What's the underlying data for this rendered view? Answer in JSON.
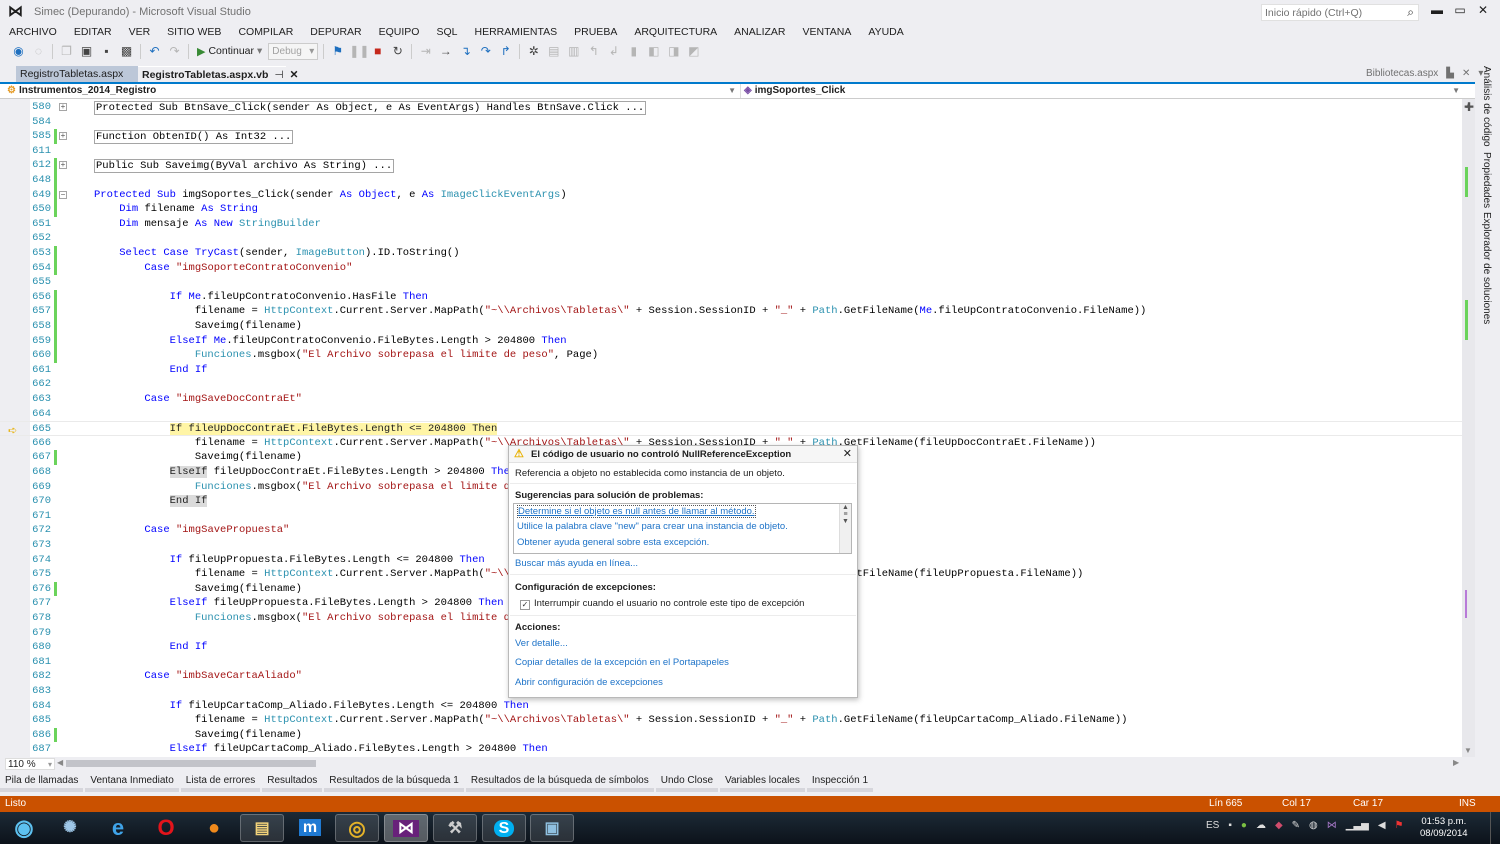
{
  "window": {
    "title": "Simec (Depurando) - Microsoft Visual Studio",
    "quick_launch_placeholder": "Inicio rápido (Ctrl+Q)"
  },
  "menu": [
    "ARCHIVO",
    "EDITAR",
    "VER",
    "SITIO WEB",
    "COMPILAR",
    "DEPURAR",
    "EQUIPO",
    "SQL",
    "HERRAMIENTAS",
    "PRUEBA",
    "ARQUITECTURA",
    "ANALIZAR",
    "VENTANA",
    "AYUDA"
  ],
  "toolbar": {
    "continue_label": "Continuar",
    "config_value": "Debug"
  },
  "tabs": [
    {
      "label": "RegistroTabletas.aspx"
    },
    {
      "label": "RegistroTabletas.aspx.vb",
      "active": true
    }
  ],
  "preview_tab": "Bibliotecas.aspx",
  "navbar": {
    "class_value": "Instrumentos_2014_Registro",
    "member_value": "imgSoportes_Click"
  },
  "side_tabs": [
    "Análisis de código",
    "Propiedades",
    "Explorador de soluciones"
  ],
  "editor": {
    "zoom": "110 %",
    "current_line": 665,
    "lines": [
      {
        "n": "580",
        "fold": "+",
        "box": true,
        "tok": [
          [
            "p",
            "Protected Sub BtnSave_Click(sender As Object, e As EventArgs) Handles BtnSave.Click ..."
          ]
        ]
      },
      {
        "n": "584",
        "tok": []
      },
      {
        "n": "585",
        "fold": "+",
        "chg": true,
        "box": true,
        "tok": [
          [
            "p",
            "Function ObtenID() As Int32 ..."
          ]
        ]
      },
      {
        "n": "611",
        "tok": []
      },
      {
        "n": "612",
        "fold": "+",
        "chg": true,
        "box": true,
        "tok": [
          [
            "p",
            "Public Sub Saveimg(ByVal archivo As String) ..."
          ]
        ]
      },
      {
        "n": "648",
        "chg": true,
        "tok": []
      },
      {
        "n": "649",
        "fold": "-",
        "chg": true,
        "tok": [
          [
            "k",
            "Protected Sub "
          ],
          [
            "p",
            "imgSoportes_Click(sender "
          ],
          [
            "k",
            "As Object"
          ],
          [
            "p",
            ", e "
          ],
          [
            "k",
            "As "
          ],
          [
            "t",
            "ImageClickEventArgs"
          ],
          [
            "p",
            ")"
          ]
        ]
      },
      {
        "n": "650",
        "chg": true,
        "tok": [
          [
            "p",
            "    "
          ],
          [
            "k",
            "Dim "
          ],
          [
            "p",
            "filename "
          ],
          [
            "k",
            "As String"
          ]
        ]
      },
      {
        "n": "651",
        "tok": [
          [
            "p",
            "    "
          ],
          [
            "k",
            "Dim "
          ],
          [
            "p",
            "mensaje "
          ],
          [
            "k",
            "As New "
          ],
          [
            "t",
            "StringBuilder"
          ]
        ]
      },
      {
        "n": "652",
        "tok": []
      },
      {
        "n": "653",
        "chg": true,
        "tok": [
          [
            "p",
            "    "
          ],
          [
            "k",
            "Select Case TryCast"
          ],
          [
            "p",
            "(sender, "
          ],
          [
            "t",
            "ImageButton"
          ],
          [
            "p",
            ").ID.ToString()"
          ]
        ]
      },
      {
        "n": "654",
        "chg": true,
        "tok": [
          [
            "p",
            "        "
          ],
          [
            "k",
            "Case "
          ],
          [
            "s",
            "\"imgSoporteContratoConvenio\""
          ]
        ]
      },
      {
        "n": "655",
        "tok": []
      },
      {
        "n": "656",
        "chg": true,
        "tok": [
          [
            "p",
            "            "
          ],
          [
            "k",
            "If Me"
          ],
          [
            "p",
            ".fileUpContratoConvenio.HasFile "
          ],
          [
            "k",
            "Then"
          ]
        ]
      },
      {
        "n": "657",
        "chg": true,
        "tok": [
          [
            "p",
            "                filename = "
          ],
          [
            "t",
            "HttpContext"
          ],
          [
            "p",
            ".Current.Server.MapPath("
          ],
          [
            "s",
            "\"~\\\\Archivos\\Tabletas\\\""
          ],
          [
            "p",
            " + Session.SessionID + "
          ],
          [
            "s",
            "\"_\""
          ],
          [
            "p",
            " + "
          ],
          [
            "t",
            "Path"
          ],
          [
            "p",
            ".GetFileName("
          ],
          [
            "k",
            "Me"
          ],
          [
            "p",
            ".fileUpContratoConvenio.FileName))"
          ]
        ]
      },
      {
        "n": "658",
        "chg": true,
        "tok": [
          [
            "p",
            "                Saveimg(filename)"
          ]
        ]
      },
      {
        "n": "659",
        "chg": true,
        "tok": [
          [
            "p",
            "            "
          ],
          [
            "k",
            "ElseIf Me"
          ],
          [
            "p",
            ".fileUpContratoConvenio.FileBytes.Length > 204800 "
          ],
          [
            "k",
            "Then"
          ]
        ]
      },
      {
        "n": "660",
        "chg": true,
        "tok": [
          [
            "p",
            "                "
          ],
          [
            "t",
            "Funciones"
          ],
          [
            "p",
            ".msgbox("
          ],
          [
            "s",
            "\"El Archivo sobrepasa el limite de peso\""
          ],
          [
            "p",
            ", Page)"
          ]
        ]
      },
      {
        "n": "661",
        "tok": [
          [
            "p",
            "            "
          ],
          [
            "k",
            "End If"
          ]
        ]
      },
      {
        "n": "662",
        "tok": []
      },
      {
        "n": "663",
        "tok": [
          [
            "p",
            "        "
          ],
          [
            "k",
            "Case "
          ],
          [
            "s",
            "\"imgSaveDocContraEt\""
          ]
        ]
      },
      {
        "n": "664",
        "tok": []
      },
      {
        "n": "665",
        "cur": true,
        "tok": [
          [
            "p",
            "            "
          ],
          [
            "cur",
            "If fileUpDocContraEt.FileBytes.Length <= 204800 Then"
          ]
        ]
      },
      {
        "n": "666",
        "tok": [
          [
            "p",
            "                filename = "
          ],
          [
            "t",
            "HttpContext"
          ],
          [
            "p",
            ".Current.Server.MapPath("
          ],
          [
            "s",
            "\"~\\\\Archivos\\Tabletas\\\""
          ],
          [
            "p",
            " + Session.SessionID + "
          ],
          [
            "s",
            "\"_\""
          ],
          [
            "p",
            " + "
          ],
          [
            "t",
            "Path"
          ],
          [
            "p",
            ".GetFileName(fileUpDocContraEt.FileName))"
          ]
        ]
      },
      {
        "n": "667",
        "chg": true,
        "tok": [
          [
            "p",
            "                Saveimg(filename)"
          ]
        ]
      },
      {
        "n": "668",
        "tok": [
          [
            "p",
            "            "
          ],
          [
            "hl",
            "ElseIf"
          ],
          [
            "p",
            " fileUpDocContraEt.FileBytes.Length > 204800 "
          ],
          [
            "k",
            "Then"
          ]
        ]
      },
      {
        "n": "669",
        "tok": [
          [
            "p",
            "                "
          ],
          [
            "t",
            "Funciones"
          ],
          [
            "p",
            ".msgbox("
          ],
          [
            "s",
            "\"El Archivo sobrepasa el limite de peso\""
          ],
          [
            "p",
            ", Page)"
          ]
        ]
      },
      {
        "n": "670",
        "tok": [
          [
            "p",
            "            "
          ],
          [
            "hl",
            "End If"
          ]
        ]
      },
      {
        "n": "671",
        "tok": []
      },
      {
        "n": "672",
        "tok": [
          [
            "p",
            "        "
          ],
          [
            "k",
            "Case "
          ],
          [
            "s",
            "\"imgSavePropuesta\""
          ]
        ]
      },
      {
        "n": "673",
        "tok": []
      },
      {
        "n": "674",
        "tok": [
          [
            "p",
            "            "
          ],
          [
            "k",
            "If "
          ],
          [
            "p",
            "fileUpPropuesta.FileBytes.Length <= 204800 "
          ],
          [
            "k",
            "Then"
          ]
        ]
      },
      {
        "n": "675",
        "tok": [
          [
            "p",
            "                filename = "
          ],
          [
            "t",
            "HttpContext"
          ],
          [
            "p",
            ".Current.Server.MapPath("
          ],
          [
            "s",
            "\"~\\\\Archivos\\Tabletas\\\""
          ],
          [
            "p",
            " + Session.SessionID + "
          ],
          [
            "s",
            "\"_\""
          ],
          [
            "p",
            " + "
          ],
          [
            "t",
            "Path"
          ],
          [
            "p",
            ".GetFileName(fileUpPropuesta.FileName))"
          ]
        ]
      },
      {
        "n": "676",
        "chg": true,
        "tok": [
          [
            "p",
            "                Saveimg(filename)"
          ]
        ]
      },
      {
        "n": "677",
        "tok": [
          [
            "p",
            "            "
          ],
          [
            "k",
            "ElseIf "
          ],
          [
            "p",
            "fileUpPropuesta.FileBytes.Length > 204800 "
          ],
          [
            "k",
            "Then"
          ]
        ]
      },
      {
        "n": "678",
        "tok": [
          [
            "p",
            "                "
          ],
          [
            "t",
            "Funciones"
          ],
          [
            "p",
            ".msgbox("
          ],
          [
            "s",
            "\"El Archivo sobrepasa el limite de peso\""
          ],
          [
            "p",
            ", Page)"
          ]
        ]
      },
      {
        "n": "679",
        "tok": []
      },
      {
        "n": "680",
        "tok": [
          [
            "p",
            "            "
          ],
          [
            "k",
            "End If"
          ]
        ]
      },
      {
        "n": "681",
        "tok": []
      },
      {
        "n": "682",
        "tok": [
          [
            "p",
            "        "
          ],
          [
            "k",
            "Case "
          ],
          [
            "s",
            "\"imbSaveCartaAliado\""
          ]
        ]
      },
      {
        "n": "683",
        "tok": []
      },
      {
        "n": "684",
        "tok": [
          [
            "p",
            "            "
          ],
          [
            "k",
            "If "
          ],
          [
            "p",
            "fileUpCartaComp_Aliado.FileBytes.Length <= 204800 "
          ],
          [
            "k",
            "Then"
          ]
        ]
      },
      {
        "n": "685",
        "tok": [
          [
            "p",
            "                filename = "
          ],
          [
            "t",
            "HttpContext"
          ],
          [
            "p",
            ".Current.Server.MapPath("
          ],
          [
            "s",
            "\"~\\\\Archivos\\Tabletas\\\""
          ],
          [
            "p",
            " + Session.SessionID + "
          ],
          [
            "s",
            "\"_\""
          ],
          [
            "p",
            " + "
          ],
          [
            "t",
            "Path"
          ],
          [
            "p",
            ".GetFileName(fileUpCartaComp_Aliado.FileName))"
          ]
        ]
      },
      {
        "n": "686",
        "chg": true,
        "tok": [
          [
            "p",
            "                Saveimg(filename)"
          ]
        ]
      },
      {
        "n": "687",
        "tok": [
          [
            "p",
            "            "
          ],
          [
            "k",
            "ElseIf "
          ],
          [
            "p",
            "fileUpCartaComp_Aliado.FileBytes.Length > 204800 "
          ],
          [
            "k",
            "Then"
          ]
        ]
      }
    ]
  },
  "exception_popup": {
    "title": "El código de usuario no controló NullReferenceException",
    "message": "Referencia a objeto no establecida como instancia de un objeto.",
    "suggestions_header": "Sugerencias para solución de problemas:",
    "suggestions": [
      "Determine si el objeto es null antes de llamar al método.",
      "Utilice la palabra clave \"new\" para crear una instancia de objeto.",
      "Obtener ayuda general sobre esta excepción."
    ],
    "search_online": "Buscar más ayuda en línea...",
    "settings_header": "Configuración de excepciones:",
    "break_checkbox_label": "Interrumpir cuando el usuario no controle este tipo de excepción",
    "break_checked": true,
    "actions_header": "Acciones:",
    "actions": [
      "Ver detalle...",
      "Copiar detalles de la excepción en el Portapapeles",
      "Abrir configuración de excepciones"
    ]
  },
  "bottom_tabs": [
    "Pila de llamadas",
    "Ventana Inmediato",
    "Lista de errores",
    "Resultados",
    "Resultados de la búsqueda 1",
    "Resultados de la búsqueda de símbolos",
    "Undo Close",
    "Variables locales",
    "Inspección 1"
  ],
  "status": {
    "text": "Listo",
    "line": "Lín 665",
    "col": "Col 17",
    "char": "Car 17",
    "mode": "INS",
    "color": "#ca5100"
  },
  "taskbar": {
    "apps": [
      "start",
      "safari",
      "internet-explorer",
      "opera",
      "firefox",
      "file-explorer",
      "maxthon",
      "chrome",
      "visual-studio",
      "tools",
      "skype",
      "remote-desktop"
    ],
    "language": "ES",
    "time": "01:53 p.m.",
    "date": "08/09/2014"
  }
}
